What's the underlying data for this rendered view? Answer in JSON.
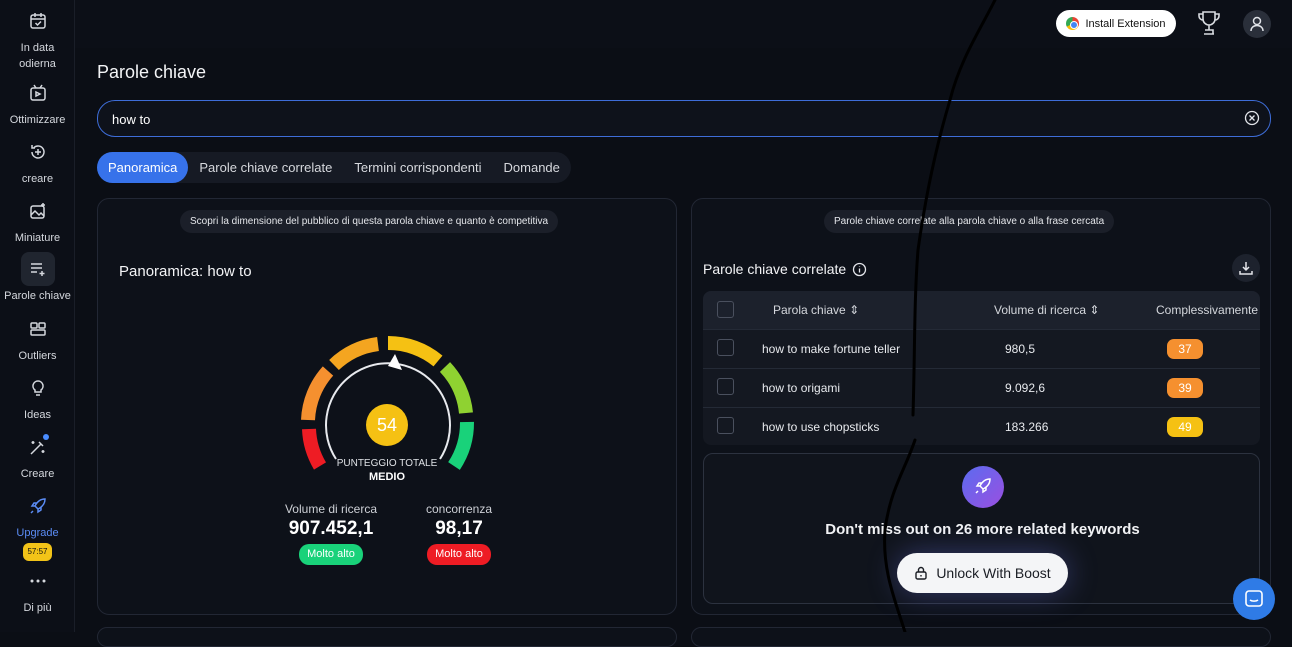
{
  "sidebar": {
    "items": [
      {
        "label_1": "In data",
        "label_2": "odierna",
        "icon": "calendar-icon"
      },
      {
        "label": "Ottimizzare",
        "icon": "video-optimize-icon"
      },
      {
        "label": "creare",
        "icon": "refresh-plus-icon"
      },
      {
        "label": "Miniature",
        "icon": "image-sparkle-icon"
      },
      {
        "label": "Parole chiave",
        "icon": "keyword-list-icon"
      },
      {
        "label": "Outliers",
        "icon": "grid-outliers-icon"
      },
      {
        "label": "Ideas",
        "icon": "lightbulb-icon"
      },
      {
        "label": "Creare",
        "icon": "magic-wand-icon"
      },
      {
        "label": "Upgrade",
        "icon": "rocket-icon",
        "timer": "57:57"
      },
      {
        "label": "Di più",
        "icon": "more-dots-icon"
      }
    ]
  },
  "topbar": {
    "install_label": "Install Extension"
  },
  "page": {
    "title": "Parole chiave"
  },
  "search": {
    "value": "how to"
  },
  "tabs": [
    "Panoramica",
    "Parole chiave correlate",
    "Termini corrispondenti",
    "Domande"
  ],
  "overview": {
    "hint": "Scopri la dimensione del pubblico di questa parola chiave e quanto è competitiva",
    "title": "Panoramica: how to",
    "score": 54,
    "score_label": "PUNTEGGIO TOTALE",
    "score_level": "MEDIO",
    "volume_label": "Volume di ricerca",
    "volume_value": "907.452,1",
    "volume_badge": "Molto alto",
    "competition_label": "concorrenza",
    "competition_value": "98,17",
    "competition_badge": "Molto alto",
    "colors": {
      "good": "#19d27a",
      "bad": "#ee1c24",
      "accent": "#3772ea"
    }
  },
  "related": {
    "hint": "Parole chiave correlate alla parola chiave o alla frase cercata",
    "title": "Parole chiave correlate",
    "columns": [
      "Parola chiave",
      "Volume di ricerca",
      "Complessivamente"
    ],
    "rows": [
      {
        "keyword": "how to make fortune teller",
        "volume": "980,5",
        "score": "37",
        "color": "#f5902f"
      },
      {
        "keyword": "how to origami",
        "volume": "9.092,6",
        "score": "39",
        "color": "#f5902f"
      },
      {
        "keyword": "how to use chopsticks",
        "volume": "183.266",
        "score": "49",
        "color": "#f5c113"
      }
    ],
    "unlock_text": "Don't miss out on 26 more related keywords",
    "unlock_button": "Unlock With Boost"
  }
}
